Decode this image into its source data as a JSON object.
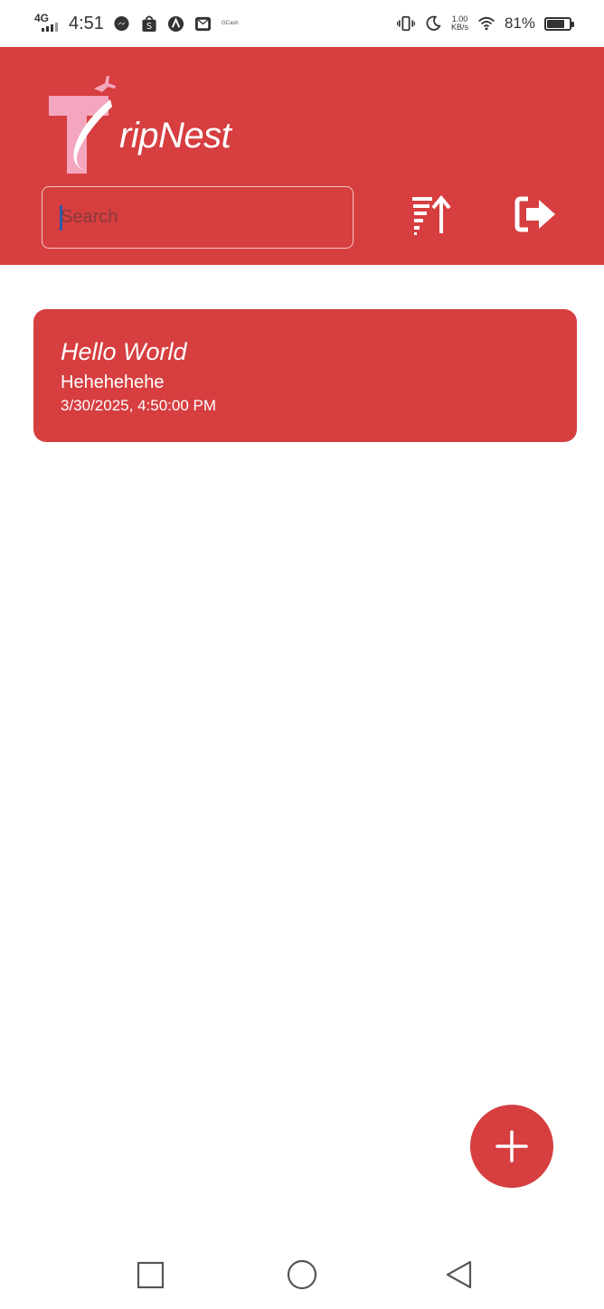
{
  "status_bar": {
    "network": "4G",
    "time": "4:51",
    "gcash_label": "GCash",
    "speed_value": "1.00",
    "speed_unit": "KB/s",
    "battery_percent": "81%",
    "battery_level": 0.81,
    "icons": [
      "messenger-icon",
      "shopee-icon",
      "app-icon",
      "gmail-icon",
      "vibrate-icon",
      "moon-icon",
      "wifi-icon",
      "battery-icon"
    ]
  },
  "header": {
    "app_name": "ripNest",
    "logo_letter": "T",
    "search_placeholder": "Search",
    "sort_icon": "sort-ascending-icon",
    "logout_icon": "logout-icon",
    "brand_color": "#d63e40"
  },
  "notes": [
    {
      "title": "Hello World",
      "body": "Hehehehehe",
      "timestamp": "3/30/2025, 4:50:00 PM"
    }
  ],
  "fab": {
    "icon": "plus-icon"
  },
  "nav": {
    "icons": [
      "recent-apps-icon",
      "home-icon",
      "back-icon"
    ]
  }
}
